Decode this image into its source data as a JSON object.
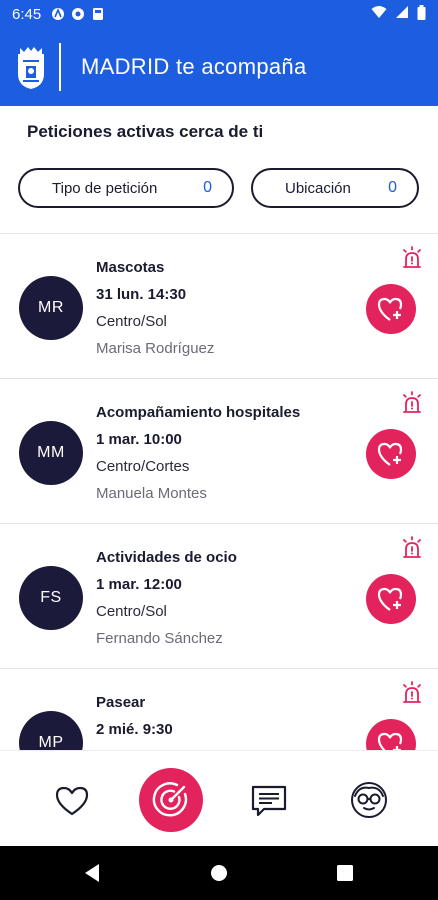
{
  "status_bar": {
    "time": "6:45",
    "left_icons": [
      "notification-icon-a",
      "notification-icon-b",
      "notification-icon-c"
    ],
    "right_icons": [
      "wifi-icon",
      "signal-icon",
      "battery-icon"
    ]
  },
  "header": {
    "title": "MADRID te acompaña",
    "background_color": "#1d5de0"
  },
  "section": {
    "title": "Peticiones activas cerca de ti"
  },
  "filters": {
    "type_label": "Tipo de petición",
    "type_count": "0",
    "location_label": "Ubicación",
    "location_count": "0"
  },
  "requests": [
    {
      "initials": "MR",
      "category": "Mascotas",
      "date": "31 lun. 14:30",
      "location": "Centro/Sol",
      "person": "Marisa Rodríguez"
    },
    {
      "initials": "MM",
      "category": "Acompañamiento hospitales",
      "date": "1 mar. 10:00",
      "location": "Centro/Cortes",
      "person": "Manuela Montes"
    },
    {
      "initials": "FS",
      "category": "Actividades de ocio",
      "date": "1 mar. 12:00",
      "location": "Centro/Sol",
      "person": "Fernando Sánchez"
    },
    {
      "initials": "MP",
      "category": "Pasear",
      "date": "2 mié. 9:30",
      "location": "",
      "person": ""
    }
  ],
  "colors": {
    "accent": "#e3245c",
    "avatar_bg": "#1b1a3a",
    "brand_blue": "#1d5de0",
    "count_blue": "#1d5de0"
  },
  "bottom_nav": {
    "items": [
      "heart-icon",
      "radar-icon",
      "chat-icon",
      "profile-icon"
    ]
  },
  "android_nav": {
    "items": [
      "back-icon",
      "home-icon",
      "recents-icon"
    ]
  }
}
